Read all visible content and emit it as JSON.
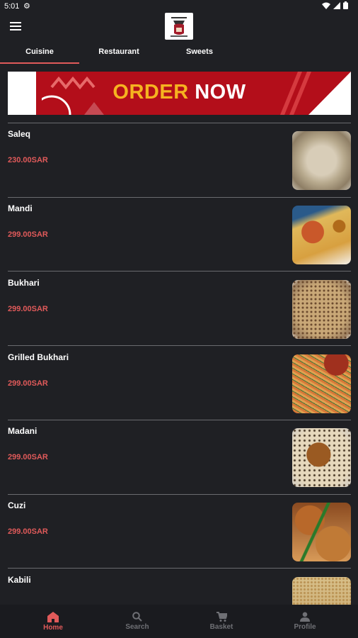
{
  "status_bar": {
    "time": "5:01"
  },
  "tabs": [
    "Cuisine",
    "Restaurant",
    "Sweets"
  ],
  "banner": {
    "order": "ORDER",
    "now": "NOW"
  },
  "items": [
    {
      "name": "Saleq",
      "price": "230.00SAR"
    },
    {
      "name": "Mandi",
      "price": "299.00SAR"
    },
    {
      "name": "Bukhari",
      "price": "299.00SAR"
    },
    {
      "name": "Grilled Bukhari",
      "price": "299.00SAR"
    },
    {
      "name": "Madani",
      "price": "299.00SAR"
    },
    {
      "name": "Cuzi",
      "price": "299.00SAR"
    },
    {
      "name": "Kabili",
      "price": ""
    }
  ],
  "bottom_nav": [
    {
      "label": "Home",
      "icon": "home-icon",
      "active": true
    },
    {
      "label": "Search",
      "icon": "search-icon",
      "active": false
    },
    {
      "label": "Basket",
      "icon": "cart-icon",
      "active": false
    },
    {
      "label": "Profile",
      "icon": "person-icon",
      "active": false
    }
  ],
  "colors": {
    "accent": "#e05a5a",
    "background": "#1f2024",
    "banner_red": "#b30e1a",
    "banner_yellow": "#f6b320"
  }
}
